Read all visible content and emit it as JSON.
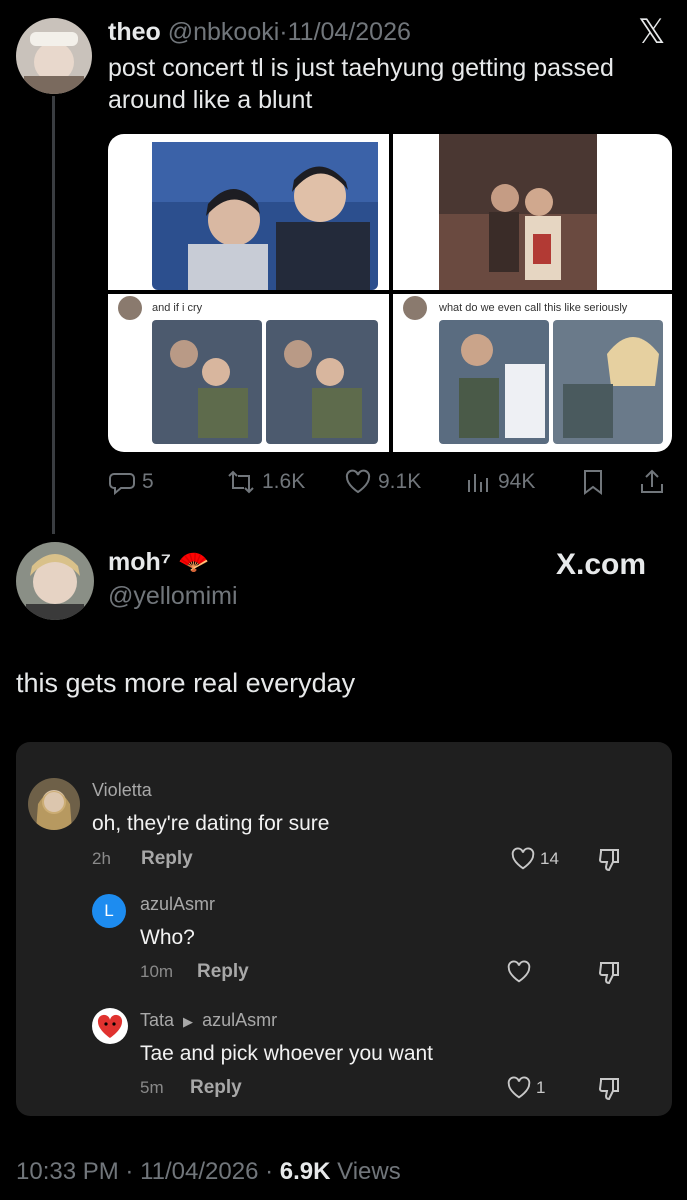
{
  "tweet1": {
    "name": "theo",
    "handle": "@nbkooki",
    "date": "11/04/2026",
    "text": "post concert tl is just taehyung getting passed around like a blunt",
    "media_captions": [
      "and if i cry",
      "what do we even call this like seriously"
    ],
    "metrics": {
      "replies": "5",
      "reposts": "1.6K",
      "likes": "9.1K",
      "views": "94K"
    }
  },
  "tweet2": {
    "name": "moh⁷",
    "handle": "@yellomimi",
    "watermark": "X.com",
    "text": "this gets more real everyday"
  },
  "comments": [
    {
      "author": "Violetta",
      "text": "oh, they're dating for sure",
      "time": "2h",
      "reply_label": "Reply",
      "likes": "14"
    },
    {
      "author": "azulAsmr",
      "avatar_letter": "L",
      "text": "Who?",
      "time": "10m",
      "reply_label": "Reply",
      "likes": ""
    },
    {
      "author": "Tata",
      "reply_to": "azulAsmr",
      "text": "Tae and pick whoever you want",
      "time": "5m",
      "reply_label": "Reply",
      "likes": "1"
    }
  ],
  "footer": {
    "time": "10:33 PM",
    "date": "11/04/2026",
    "views_count": "6.9K",
    "views_label": "Views"
  },
  "colors": {
    "background": "#000000",
    "muted": "#71767b",
    "card": "#1f1f1f",
    "azul_avatar": "#1d8cf0"
  }
}
